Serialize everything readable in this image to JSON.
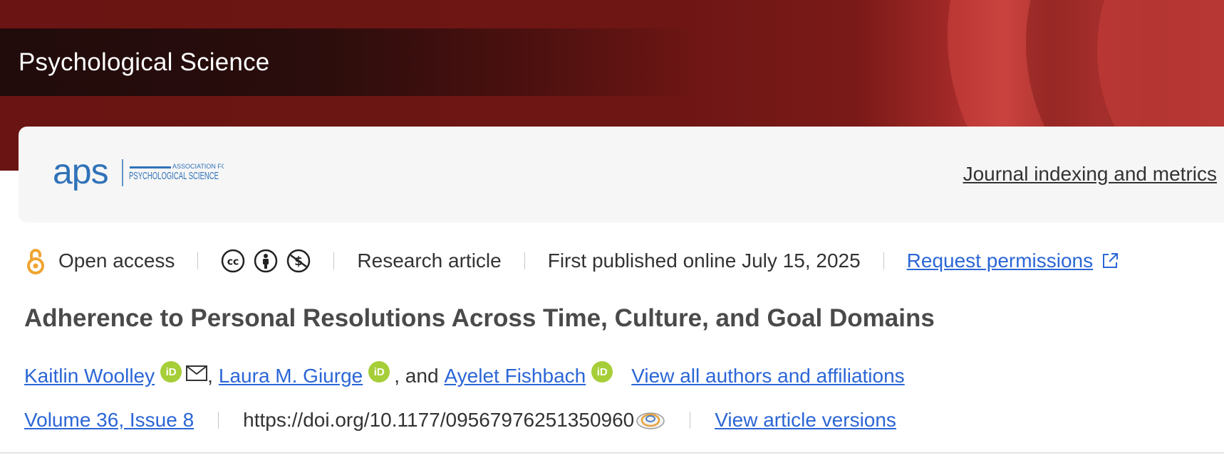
{
  "journal": {
    "title": "Psychological Science"
  },
  "logo": {
    "mark": "aps",
    "line1": "ASSOCIATION FOR",
    "line2": "PSYCHOLOGICAL SCIENCE",
    "color": "#2f72b8"
  },
  "header_links": {
    "indexing": "Journal indexing and metrics"
  },
  "meta": {
    "open_access": "Open access",
    "license_icons": [
      "cc-icon",
      "attribution-icon",
      "noncommercial-icon"
    ],
    "type": "Research article",
    "published": "First published online July 15, 2025",
    "permissions": "Request permissions"
  },
  "article": {
    "title": "Adherence to Personal Resolutions Across Time, Culture, and Goal Domains",
    "authors": [
      {
        "name": "Kaitlin Woolley"
      },
      {
        "name": "Laura M. Giurge"
      },
      {
        "name": "Ayelet Fishbach"
      }
    ],
    "author_sep": ",",
    "author_and": ", and",
    "view_authors": "View all authors and affiliations",
    "volume": "Volume 36, Issue 8",
    "doi": "https://doi.org/10.1177/09567976251350960",
    "view_versions": "View article versions"
  },
  "colors": {
    "banner": "#6e1614",
    "link": "#2b66d6",
    "orcid": "#a6ce39",
    "open_access": "#f0a431"
  },
  "icons": {
    "orcid": "orcid-icon",
    "email": "email-icon",
    "external": "external-link-icon",
    "crossmark": "crossmark-icon"
  }
}
